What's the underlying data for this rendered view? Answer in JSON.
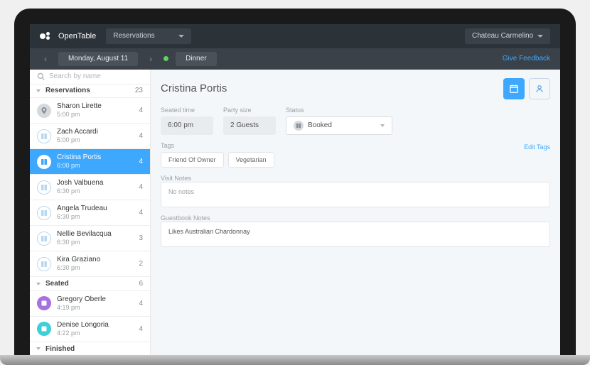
{
  "header": {
    "brand": "OpenTable",
    "nav_dropdown": "Reservations",
    "venue_dropdown": "Chateau Carmelino"
  },
  "subheader": {
    "date": "Monday, August 11",
    "meal": "Dinner",
    "feedback": "Give Feedback"
  },
  "sidebar": {
    "search_placeholder": "Search by name",
    "sections": [
      {
        "title": "Reservations",
        "count": "23"
      },
      {
        "title": "Seated",
        "count": "6"
      },
      {
        "title": "Finished",
        "count": ""
      }
    ],
    "reservations": [
      {
        "name": "Sharon Lirette",
        "time": "5:00 pm",
        "party": "4",
        "icon": "pin",
        "style": "gray"
      },
      {
        "name": "Zach Accardi",
        "time": "5:00 pm",
        "party": "4",
        "icon": "book",
        "style": "blue-outline"
      },
      {
        "name": "Cristina Portis",
        "time": "6:00 pm",
        "party": "4",
        "icon": "book",
        "style": "white",
        "selected": true
      },
      {
        "name": "Josh Valbuena",
        "time": "6:30 pm",
        "party": "4",
        "icon": "book",
        "style": "blue-outline"
      },
      {
        "name": "Angela Trudeau",
        "time": "6:30 pm",
        "party": "4",
        "icon": "book",
        "style": "blue-outline"
      },
      {
        "name": "Nellie Bevilacqua",
        "time": "6:30 pm",
        "party": "3",
        "icon": "book",
        "style": "blue-outline"
      },
      {
        "name": "Kira Graziano",
        "time": "6:30 pm",
        "party": "2",
        "icon": "book",
        "style": "blue-outline"
      }
    ],
    "seated": [
      {
        "name": "Gregory Oberle",
        "time": "4:19 pm",
        "party": "4",
        "icon": "square",
        "style": "purple"
      },
      {
        "name": "Denise Longoria",
        "time": "4:22 pm",
        "party": "4",
        "icon": "square",
        "style": "cyan"
      }
    ]
  },
  "detail": {
    "guest_name": "Cristina Portis",
    "fields": {
      "seated_time_label": "Seated time",
      "seated_time": "6:00 pm",
      "party_size_label": "Party size",
      "party_size": "2 Guests",
      "status_label": "Status",
      "status": "Booked"
    },
    "tags_label": "Tags",
    "edit_tags": "Edit Tags",
    "tags": [
      "Friend Of Owner",
      "Vegetarian"
    ],
    "visit_notes_label": "Visit Notes",
    "visit_notes": "No notes",
    "guestbook_label": "Guestbook Notes",
    "guestbook_notes": "Likes Australian Chardonnay"
  }
}
